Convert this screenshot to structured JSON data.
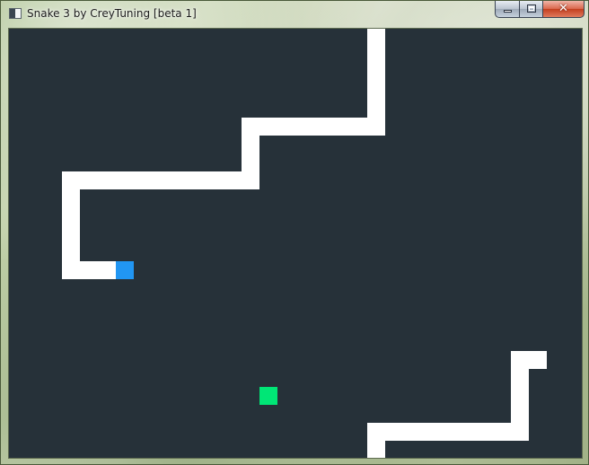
{
  "window": {
    "title": "Snake 3 by CreyTuning [beta 1]",
    "icon": "app-window-icon",
    "close_glyph": "✕"
  },
  "game": {
    "grid_columns": 32,
    "grid_rows": 24,
    "background_color": "#263139",
    "colors": {
      "snake_body": "#ffffff",
      "snake_head": "#2196f3",
      "food": "#00e676"
    },
    "snake_head": [
      6,
      13
    ],
    "snake_body": [
      [
        5,
        13
      ],
      [
        4,
        13
      ],
      [
        3,
        13
      ],
      [
        3,
        12
      ],
      [
        3,
        11
      ],
      [
        3,
        10
      ],
      [
        3,
        9
      ],
      [
        3,
        8
      ],
      [
        4,
        8
      ],
      [
        5,
        8
      ],
      [
        6,
        8
      ],
      [
        7,
        8
      ],
      [
        8,
        8
      ],
      [
        9,
        8
      ],
      [
        10,
        8
      ],
      [
        11,
        8
      ],
      [
        12,
        8
      ],
      [
        13,
        8
      ],
      [
        13,
        7
      ],
      [
        13,
        6
      ],
      [
        13,
        5
      ],
      [
        14,
        5
      ],
      [
        15,
        5
      ],
      [
        16,
        5
      ],
      [
        17,
        5
      ],
      [
        18,
        5
      ],
      [
        19,
        5
      ],
      [
        20,
        5
      ],
      [
        20,
        4
      ],
      [
        20,
        3
      ],
      [
        20,
        2
      ],
      [
        20,
        1
      ],
      [
        20,
        0
      ],
      [
        20,
        23
      ],
      [
        20,
        22
      ],
      [
        21,
        22
      ],
      [
        22,
        22
      ],
      [
        23,
        22
      ],
      [
        24,
        22
      ],
      [
        25,
        22
      ],
      [
        26,
        22
      ],
      [
        27,
        22
      ],
      [
        28,
        22
      ],
      [
        28,
        21
      ],
      [
        28,
        20
      ],
      [
        28,
        19
      ],
      [
        28,
        18
      ],
      [
        29,
        18
      ]
    ],
    "food": [
      14,
      20
    ]
  }
}
